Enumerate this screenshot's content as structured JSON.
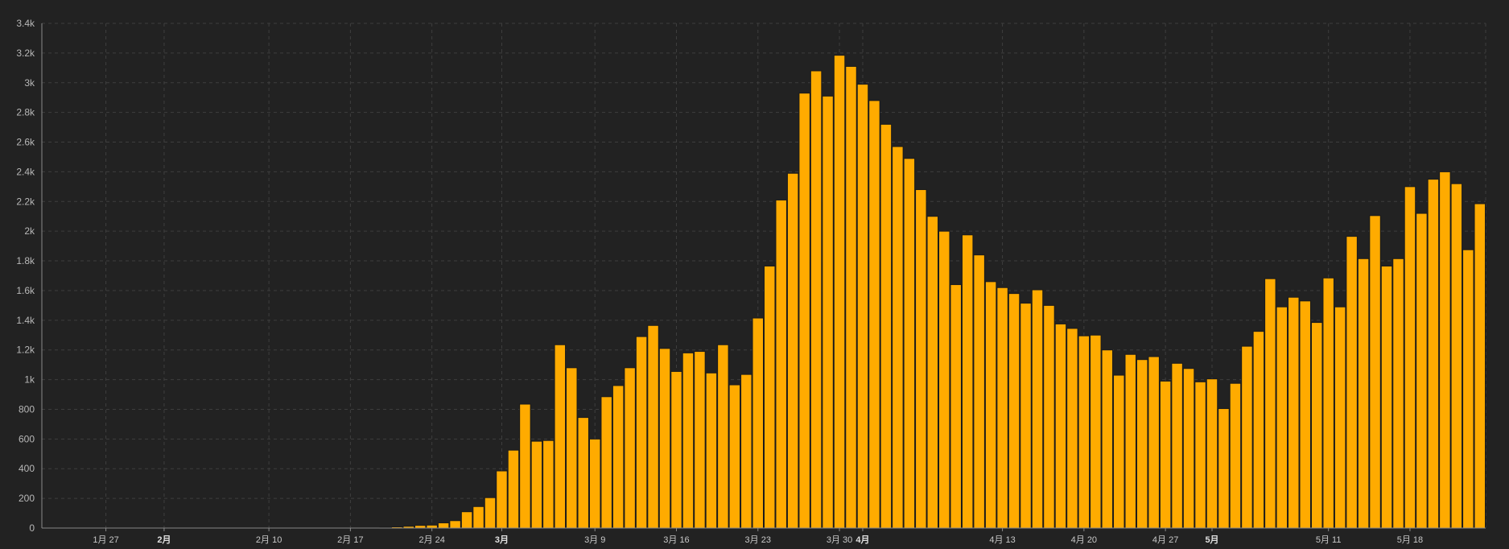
{
  "chart_data": {
    "type": "bar",
    "title": "",
    "xlabel": "",
    "ylabel": "",
    "ylim": [
      0,
      3400
    ],
    "y_ticks": [
      0,
      200,
      400,
      600,
      800,
      1000,
      1200,
      1400,
      1600,
      1800,
      2000,
      2200,
      2400,
      2600,
      2800,
      3000,
      3200,
      3400
    ],
    "y_tick_labels": [
      "0",
      "200",
      "400",
      "600",
      "800",
      "1k",
      "1.2k",
      "1.4k",
      "1.6k",
      "1.8k",
      "2k",
      "2.2k",
      "2.4k",
      "2.6k",
      "2.8k",
      "3k",
      "3.2k",
      "3.4k"
    ],
    "x_start": "2020-01-22",
    "x_ticks": [
      {
        "label": "1月 27",
        "index": 5,
        "bold": false
      },
      {
        "label": "2月",
        "index": 10,
        "bold": true
      },
      {
        "label": "2月 10",
        "index": 19,
        "bold": false
      },
      {
        "label": "2月 17",
        "index": 26,
        "bold": false
      },
      {
        "label": "2月 24",
        "index": 33,
        "bold": false
      },
      {
        "label": "3月",
        "index": 39,
        "bold": true
      },
      {
        "label": "3月 9",
        "index": 47,
        "bold": false
      },
      {
        "label": "3月 16",
        "index": 54,
        "bold": false
      },
      {
        "label": "3月 23",
        "index": 61,
        "bold": false
      },
      {
        "label": "3月 30",
        "index": 68,
        "bold": false
      },
      {
        "label": "4月",
        "index": 70,
        "bold": true
      },
      {
        "label": "4月 13",
        "index": 82,
        "bold": false
      },
      {
        "label": "4月 20",
        "index": 89,
        "bold": false
      },
      {
        "label": "4月 27",
        "index": 96,
        "bold": false
      },
      {
        "label": "5月",
        "index": 100,
        "bold": true
      },
      {
        "label": "5月 11",
        "index": 110,
        "bold": false
      },
      {
        "label": "5月 18",
        "index": 117,
        "bold": false
      }
    ],
    "values": [
      0,
      0,
      0,
      0,
      0,
      0,
      0,
      0,
      0,
      0,
      0,
      0,
      0,
      0,
      0,
      0,
      0,
      0,
      0,
      0,
      0,
      0,
      0,
      0,
      0,
      0,
      0,
      0,
      0,
      5,
      8,
      12,
      18,
      20,
      35,
      50,
      110,
      145,
      205,
      385,
      525,
      835,
      585,
      590,
      1235,
      1080,
      745,
      600,
      885,
      960,
      1080,
      1290,
      1365,
      1210,
      1055,
      1180,
      1190,
      1045,
      1235,
      965,
      1035,
      1415,
      1765,
      2210,
      2390,
      2930,
      3080,
      2910,
      3185,
      3110,
      2990,
      2880,
      2720,
      2570,
      2490,
      2280,
      2100,
      2000,
      1640,
      1975,
      1840,
      1660,
      1620,
      1580,
      1515,
      1605,
      1500,
      1375,
      1345,
      1295,
      1300,
      1200,
      1030,
      1170,
      1135,
      1155,
      990,
      1110,
      1075,
      985,
      1005,
      805,
      975,
      1225,
      1325,
      1680,
      1490,
      1555,
      1530,
      1385,
      1685,
      1490,
      1965,
      1815,
      2105,
      1765,
      1815,
      2300,
      2120,
      2350,
      2400,
      2320,
      1875,
      2185
    ],
    "bar_color": "#ffab00",
    "background": "#222222",
    "grid": true
  }
}
